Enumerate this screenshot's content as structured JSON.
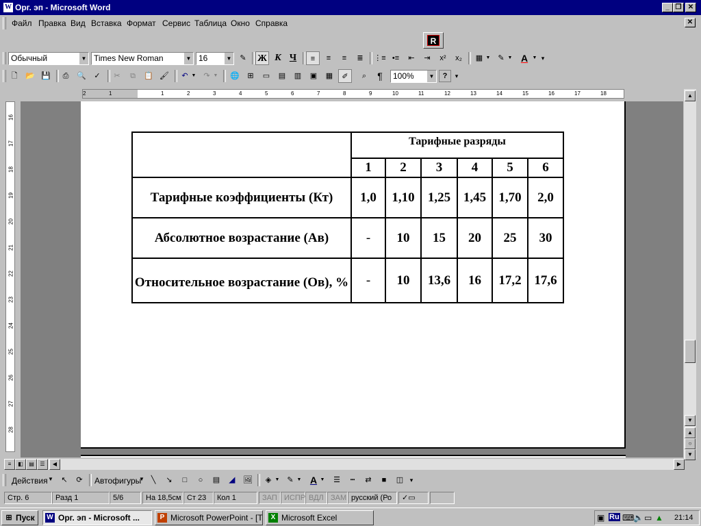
{
  "window": {
    "title": "Орг. эп - Microsoft Word",
    "word_icon": "W",
    "minimize_glyph": "_",
    "restore_glyph": "❐",
    "close_glyph": "✕"
  },
  "menu": {
    "items": [
      {
        "label": "Файл"
      },
      {
        "label": "Правка"
      },
      {
        "label": "Вид"
      },
      {
        "label": "Вставка"
      },
      {
        "label": "Формат"
      },
      {
        "label": "Сервис"
      },
      {
        "label": "Таблица"
      },
      {
        "label": "Окно"
      },
      {
        "label": "Справка"
      }
    ],
    "doc_close_glyph": "✕"
  },
  "floating_toolbar": {
    "icon": "R"
  },
  "formatting": {
    "style": "Обычный",
    "font": "Times New Roman",
    "size": "16",
    "bold": "Ж",
    "italic": "К",
    "underline": "Ч",
    "superscript": "x²",
    "subscript": "x₂"
  },
  "standard": {
    "zoom": "100%",
    "help_glyph": "?"
  },
  "ruler": {
    "h_numbers": [
      "2",
      "1",
      "1",
      "2",
      "3",
      "4",
      "5",
      "6",
      "7",
      "8",
      "9",
      "10",
      "11",
      "12",
      "13",
      "14",
      "15",
      "16",
      "17",
      "18"
    ],
    "v_numbers": [
      "16",
      "17",
      "18",
      "19",
      "20",
      "21",
      "22",
      "23",
      "24",
      "25",
      "26",
      "27",
      "28"
    ]
  },
  "table": {
    "header_group": "Тарифные разряды",
    "grades": [
      "1",
      "2",
      "3",
      "4",
      "5",
      "6"
    ],
    "rows": [
      {
        "label": "Тарифные коэффициенты (Кт)",
        "values": [
          "1,0",
          "1,10",
          "1,25",
          "1,45",
          "1,70",
          "2,0"
        ]
      },
      {
        "label": "Абсолютное возрастание (Ав)",
        "values": [
          "-",
          "10",
          "15",
          "20",
          "25",
          "30"
        ]
      },
      {
        "label": "Относительное возрастание (Ов), %",
        "values": [
          "-",
          "10",
          "13,6",
          "16",
          "17,2",
          "17,6"
        ]
      }
    ]
  },
  "drawing": {
    "actions": "Действия",
    "autoshapes": "Автофигуры"
  },
  "status": {
    "page": "Стр.  6",
    "section": "Разд  1",
    "pages": "5/6",
    "position": "На 18,5см",
    "line": "Ст  23",
    "column": "Кол  1",
    "rec": "ЗАП",
    "trk": "ИСПР",
    "ext": "ВДЛ",
    "ovr": "ЗАМ",
    "language": "русский (Ро"
  },
  "taskbar": {
    "start": "Пуск",
    "tasks": [
      {
        "label": "Орг. эп - Microsoft ...",
        "icon": "W",
        "color": "#000080",
        "active": true
      },
      {
        "label": "Microsoft PowerPoint - [Те...",
        "icon": "P",
        "color": "#c04000",
        "active": false
      },
      {
        "label": "Microsoft Excel",
        "icon": "X",
        "color": "#008000",
        "active": false
      }
    ],
    "tray_lang": "Ru",
    "clock": "21:14"
  }
}
